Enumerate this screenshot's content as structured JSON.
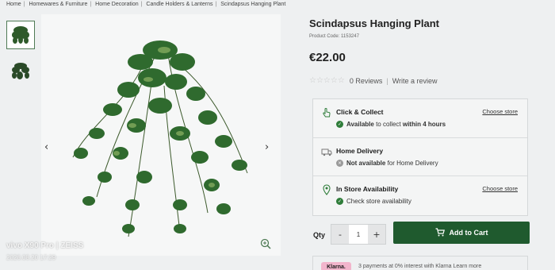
{
  "breadcrumb": [
    "Home",
    "Homewares & Furniture",
    "Home Decoration",
    "Candle Holders & Lanterns",
    "Scindapsus Hanging Plant"
  ],
  "product": {
    "title": "Scindapsus Hanging Plant",
    "code": "Product Code: 1153247",
    "price": "€22.00",
    "reviews": "0 Reviews",
    "write_review": "Write a review",
    "rating_stars": 0
  },
  "delivery": {
    "click_collect": {
      "title": "Click & Collect",
      "status_strong": "Available",
      "status_mid": " to collect ",
      "status_strong2": "within 4 hours",
      "link": "Choose store",
      "icon": "hand-pointer-icon"
    },
    "home_delivery": {
      "title": "Home Delivery",
      "status_strong": "Not available",
      "status_rest": " for Home Delivery",
      "icon": "truck-icon"
    },
    "in_store": {
      "title": "In Store Availability",
      "status": "Check store availability",
      "link": "Choose store",
      "icon": "map-pin-icon"
    }
  },
  "purchase": {
    "qty_label": "Qty",
    "qty_value": "1",
    "minus": "-",
    "plus": "+",
    "add_to_cart": "Add to Cart"
  },
  "promo": {
    "klarna": "Klarna.",
    "text": "3 payments at 0% interest with Klarna Learn more"
  },
  "gallery": {
    "prev": "‹",
    "next": "›"
  },
  "watermark": {
    "brand": "vivo X90 Pro | ZEISS",
    "date": "2026.08.20 17:29"
  },
  "colors": {
    "accent": "#1f5a2e",
    "ok": "#2f7d3a",
    "na": "#9a9a9a",
    "klarna": "#f2b5cc"
  }
}
